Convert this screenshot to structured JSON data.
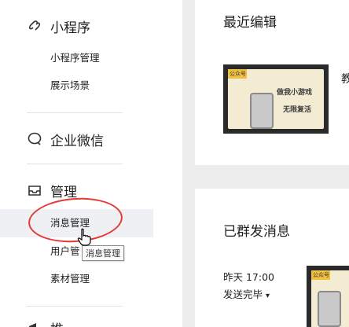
{
  "sidebar": {
    "miniprogram": {
      "title": "小程序",
      "icon": "link-icon",
      "items": [
        "小程序管理",
        "展示场景"
      ]
    },
    "wecom": {
      "title": "企业微信",
      "icon": "chat-bubble-icon"
    },
    "manage": {
      "title": "管理",
      "icon": "inbox-icon",
      "items": [
        "消息管理",
        "用户管",
        "素材管理"
      ]
    },
    "next_section_partial": "推"
  },
  "tooltip": "消息管理",
  "recent_edit": {
    "title": "最近编辑",
    "thumb_badge": "公众号",
    "thumb_line1": "做我小游戏",
    "thumb_line2": "无限复活",
    "side_text_partial": "教"
  },
  "mass_sent": {
    "title": "已群发消息",
    "time": "昨天 17:00",
    "status": "发送完毕",
    "status_caret": "▾",
    "thumb_badge": "公众号"
  },
  "colors": {
    "highlight_oval": "#e53935",
    "active_row": "#eef0f3",
    "background": "#ededed"
  }
}
